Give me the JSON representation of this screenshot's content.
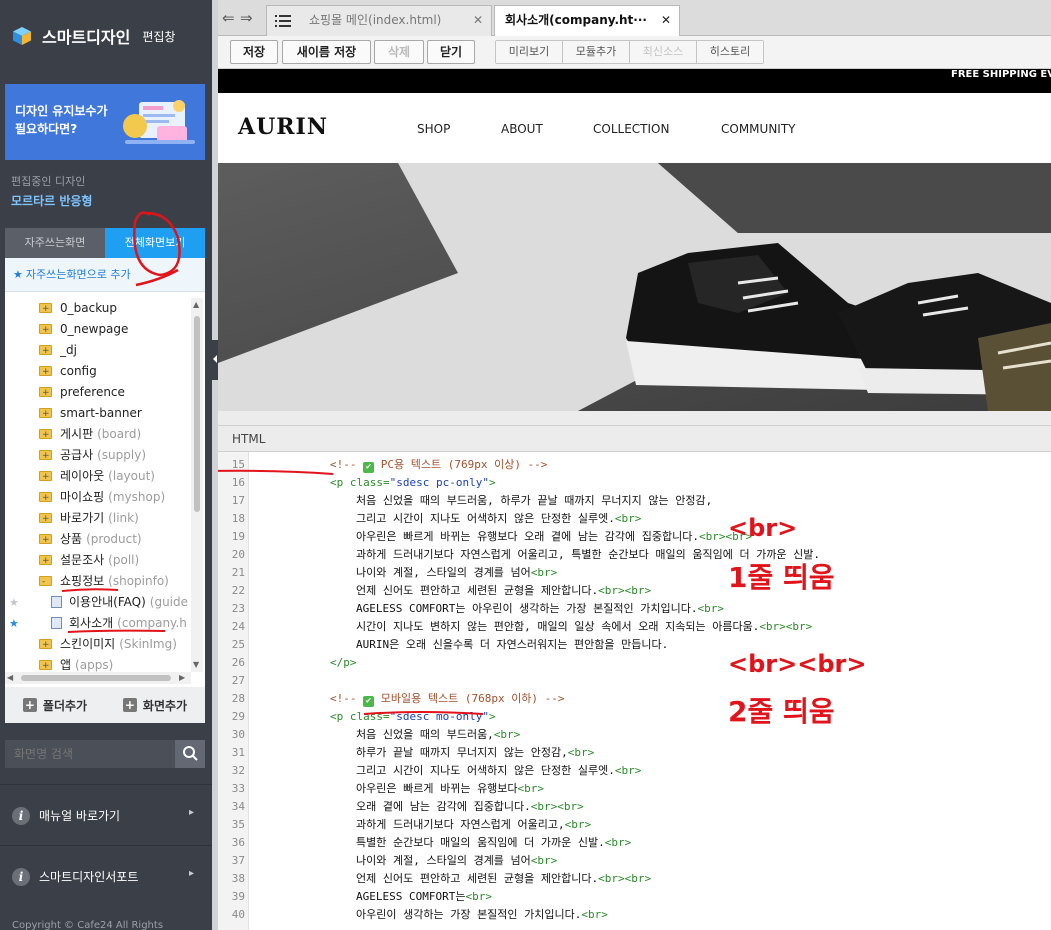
{
  "sidebar": {
    "title": "스마트디자인",
    "subtitle": "편집창",
    "banner": {
      "text": "디자인 유지보수가\n필요하다면?"
    },
    "editing_label": "편집중인 디자인",
    "editing_name": "모르타르 반응형",
    "tabs": [
      {
        "label": "자주쓰는화면",
        "active": false
      },
      {
        "label": "전체화면보기",
        "active": true
      }
    ],
    "add_favorite": "자주쓰는화면으로 추가",
    "tree": [
      {
        "label": "0_backup",
        "sub": "",
        "type": "dir"
      },
      {
        "label": "0_newpage",
        "sub": "",
        "type": "dir"
      },
      {
        "label": "_dj",
        "sub": "",
        "type": "dir"
      },
      {
        "label": "config",
        "sub": "",
        "type": "dir"
      },
      {
        "label": "preference",
        "sub": "",
        "type": "dir"
      },
      {
        "label": "smart-banner",
        "sub": "",
        "type": "dir"
      },
      {
        "label": "게시판",
        "sub": "(board)",
        "type": "dir"
      },
      {
        "label": "공급사",
        "sub": "(supply)",
        "type": "dir"
      },
      {
        "label": "레이아웃",
        "sub": "(layout)",
        "type": "dir"
      },
      {
        "label": "마이쇼핑",
        "sub": "(myshop)",
        "type": "dir"
      },
      {
        "label": "바로가기",
        "sub": "(link)",
        "type": "dir"
      },
      {
        "label": "상품",
        "sub": "(product)",
        "type": "dir"
      },
      {
        "label": "설문조사",
        "sub": "(poll)",
        "type": "dir"
      },
      {
        "label": "쇼핑정보",
        "sub": "(shopinfo)",
        "type": "dir-open"
      },
      {
        "label": "이용안내(FAQ)",
        "sub": "(guide",
        "type": "page",
        "fav": "gray"
      },
      {
        "label": "회사소개",
        "sub": "(company.h",
        "type": "page",
        "fav": "blue"
      },
      {
        "label": "스킨이미지",
        "sub": "(SkinImg)",
        "type": "dir"
      },
      {
        "label": "앱",
        "sub": "(apps)",
        "type": "dir"
      }
    ],
    "add_folder": "폴더추가",
    "add_screen": "화면추가",
    "search_placeholder": "화면명 검색",
    "menu": [
      {
        "label": "매뉴얼 바로가기"
      },
      {
        "label": "스마트디자인서포트"
      }
    ],
    "copyright": "Copyright © Cafe24 All Rights"
  },
  "tabs": [
    {
      "label": "쇼핑몰 메인(index.html)",
      "active": false
    },
    {
      "label": "회사소개(company.ht···",
      "active": true
    }
  ],
  "toolbar": {
    "save": "저장",
    "save_as": "새이름 저장",
    "delete": "삭제",
    "close": "닫기",
    "preview": "미리보기",
    "add_module": "모듈추가",
    "latest_source": "최신소스",
    "history": "히스토리"
  },
  "site": {
    "promo": "FREE SHIPPING EVE",
    "logo": "AURIN",
    "nav": [
      "SHOP",
      "ABOUT",
      "COLLECTION",
      "COMMUNITY"
    ]
  },
  "editor": {
    "label": "HTML",
    "lines": [
      {
        "n": "15",
        "indent": 0,
        "parts": [
          {
            "t": "<!-- ",
            "c": "c-comment"
          },
          {
            "t": "✔",
            "c": "check"
          },
          {
            "t": " PC용 텍스트 (769px 이상) -->",
            "c": "c-comment"
          }
        ]
      },
      {
        "n": "16",
        "indent": 0,
        "parts": [
          {
            "t": "<p class=",
            "c": "c-tag"
          },
          {
            "t": "\"sdesc pc-only\"",
            "c": "c-str"
          },
          {
            "t": ">",
            "c": "c-tag"
          }
        ]
      },
      {
        "n": "17",
        "indent": 1,
        "parts": [
          {
            "t": "처음 신었을 때의 부드러움, 하루가 끝날 때까지 무너지지 않는 안정감,",
            "c": ""
          }
        ]
      },
      {
        "n": "18",
        "indent": 1,
        "parts": [
          {
            "t": "그리고 시간이 지나도 어색하지 않은 단정한 실루엣.",
            "c": ""
          },
          {
            "t": "<br>",
            "c": "c-tag"
          }
        ]
      },
      {
        "n": "19",
        "indent": 1,
        "parts": [
          {
            "t": "아우린은 빠르게 바뀌는 유행보다 오래 곁에 남는 감각에 집중합니다.",
            "c": ""
          },
          {
            "t": "<br><br>",
            "c": "c-tag"
          }
        ]
      },
      {
        "n": "20",
        "indent": 1,
        "parts": [
          {
            "t": "과하게 드러내기보다 자연스럽게 어울리고, 특별한 순간보다 매일의 움직임에 더 가까운 신발.",
            "c": ""
          }
        ]
      },
      {
        "n": "21",
        "indent": 1,
        "parts": [
          {
            "t": "나이와 계절, 스타일의 경계를 넘어",
            "c": ""
          },
          {
            "t": "<br>",
            "c": "c-tag"
          }
        ]
      },
      {
        "n": "22",
        "indent": 1,
        "parts": [
          {
            "t": "언제 신어도 편안하고 세련된 균형을 제안합니다.",
            "c": ""
          },
          {
            "t": "<br><br>",
            "c": "c-tag"
          }
        ]
      },
      {
        "n": "23",
        "indent": 1,
        "parts": [
          {
            "t": "AGELESS COMFORT는 아우린이 생각하는 가장 본질적인 가치입니다.",
            "c": ""
          },
          {
            "t": "<br>",
            "c": "c-tag"
          }
        ]
      },
      {
        "n": "24",
        "indent": 1,
        "parts": [
          {
            "t": "시간이 지나도 변하지 않는 편안함, 매일의 일상 속에서 오래 지속되는 아름다움.",
            "c": ""
          },
          {
            "t": "<br><br>",
            "c": "c-tag"
          }
        ]
      },
      {
        "n": "25",
        "indent": 1,
        "parts": [
          {
            "t": "AURIN은 오래 신을수록 더 자연스러워지는 편안함을 만듭니다.",
            "c": ""
          }
        ]
      },
      {
        "n": "26",
        "indent": 0,
        "parts": [
          {
            "t": "</p>",
            "c": "c-tag"
          }
        ]
      },
      {
        "n": "27",
        "indent": 0,
        "parts": []
      },
      {
        "n": "28",
        "indent": 0,
        "parts": [
          {
            "t": "<!-- ",
            "c": "c-comment"
          },
          {
            "t": "✔",
            "c": "check"
          },
          {
            "t": " 모바일용 텍스트 (768px 이하) -->",
            "c": "c-comment"
          }
        ]
      },
      {
        "n": "29",
        "indent": 0,
        "parts": [
          {
            "t": "<p class=",
            "c": "c-tag"
          },
          {
            "t": "\"sdesc mo-only\"",
            "c": "c-str"
          },
          {
            "t": ">",
            "c": "c-tag"
          }
        ]
      },
      {
        "n": "30",
        "indent": 1,
        "parts": [
          {
            "t": "처음 신었을 때의 부드러움,",
            "c": ""
          },
          {
            "t": "<br>",
            "c": "c-tag"
          }
        ]
      },
      {
        "n": "31",
        "indent": 1,
        "parts": [
          {
            "t": "하루가 끝날 때까지 무너지지 않는 안정감,",
            "c": ""
          },
          {
            "t": "<br>",
            "c": "c-tag"
          }
        ]
      },
      {
        "n": "32",
        "indent": 1,
        "parts": [
          {
            "t": "그리고 시간이 지나도 어색하지 않은 단정한 실루엣.",
            "c": ""
          },
          {
            "t": "<br>",
            "c": "c-tag"
          }
        ]
      },
      {
        "n": "33",
        "indent": 1,
        "parts": [
          {
            "t": "아우린은 빠르게 바뀌는 유행보다",
            "c": ""
          },
          {
            "t": "<br>",
            "c": "c-tag"
          }
        ]
      },
      {
        "n": "34",
        "indent": 1,
        "parts": [
          {
            "t": "오래 곁에 남는 감각에 집중합니다.",
            "c": ""
          },
          {
            "t": "<br><br>",
            "c": "c-tag"
          }
        ]
      },
      {
        "n": "35",
        "indent": 1,
        "parts": [
          {
            "t": "과하게 드러내기보다 자연스럽게 어울리고,",
            "c": ""
          },
          {
            "t": "<br>",
            "c": "c-tag"
          }
        ]
      },
      {
        "n": "36",
        "indent": 1,
        "parts": [
          {
            "t": "특별한 순간보다 매일의 움직임에 더 가까운 신발.",
            "c": ""
          },
          {
            "t": "<br>",
            "c": "c-tag"
          }
        ]
      },
      {
        "n": "37",
        "indent": 1,
        "parts": [
          {
            "t": "나이와 계절, 스타일의 경계를 넘어",
            "c": ""
          },
          {
            "t": "<br>",
            "c": "c-tag"
          }
        ]
      },
      {
        "n": "38",
        "indent": 1,
        "parts": [
          {
            "t": "언제 신어도 편안하고 세련된 균형을 제안합니다.",
            "c": ""
          },
          {
            "t": "<br><br>",
            "c": "c-tag"
          }
        ]
      },
      {
        "n": "39",
        "indent": 1,
        "parts": [
          {
            "t": "AGELESS COMFORT는",
            "c": ""
          },
          {
            "t": "<br>",
            "c": "c-tag"
          }
        ]
      },
      {
        "n": "40",
        "indent": 1,
        "parts": [
          {
            "t": "아우린이 생각하는 가장 본질적인 가치입니다.",
            "c": ""
          },
          {
            "t": "<br>",
            "c": "c-tag"
          }
        ]
      }
    ]
  },
  "annotations": {
    "br_one": "<br>",
    "one_line": "1줄 띄움",
    "br_two": "<br><br>",
    "two_line": "2줄 띄움"
  },
  "colors": {
    "sidebar_bg": "#3b3f47",
    "accent_blue": "#1e9ff2",
    "annotation_red": "#e0141a"
  }
}
